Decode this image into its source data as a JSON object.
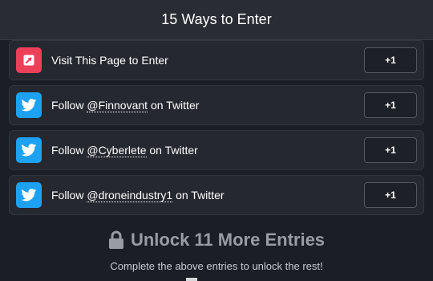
{
  "header": {
    "title": "15 Ways to Enter"
  },
  "entries": [
    {
      "icon": "external-link-icon",
      "text_before": "Visit This Page to Enter",
      "handle": "",
      "text_after": "",
      "points": "+1"
    },
    {
      "icon": "twitter-icon",
      "text_before": "Follow ",
      "handle": "@Finnovant",
      "text_after": " on Twitter",
      "points": "+1"
    },
    {
      "icon": "twitter-icon",
      "text_before": "Follow ",
      "handle": "@Cyberlete",
      "text_after": " on Twitter",
      "points": "+1"
    },
    {
      "icon": "twitter-icon",
      "text_before": "Follow ",
      "handle": "@droneindustry1",
      "text_after": " on Twitter",
      "points": "+1"
    }
  ],
  "unlock": {
    "title": "Unlock 11 More Entries",
    "subtitle": "Complete the above entries to unlock the rest!"
  },
  "colors": {
    "visit_icon_bg": "#ee3f59",
    "twitter_icon_bg": "#1da1f2",
    "background": "#1c1e26"
  }
}
